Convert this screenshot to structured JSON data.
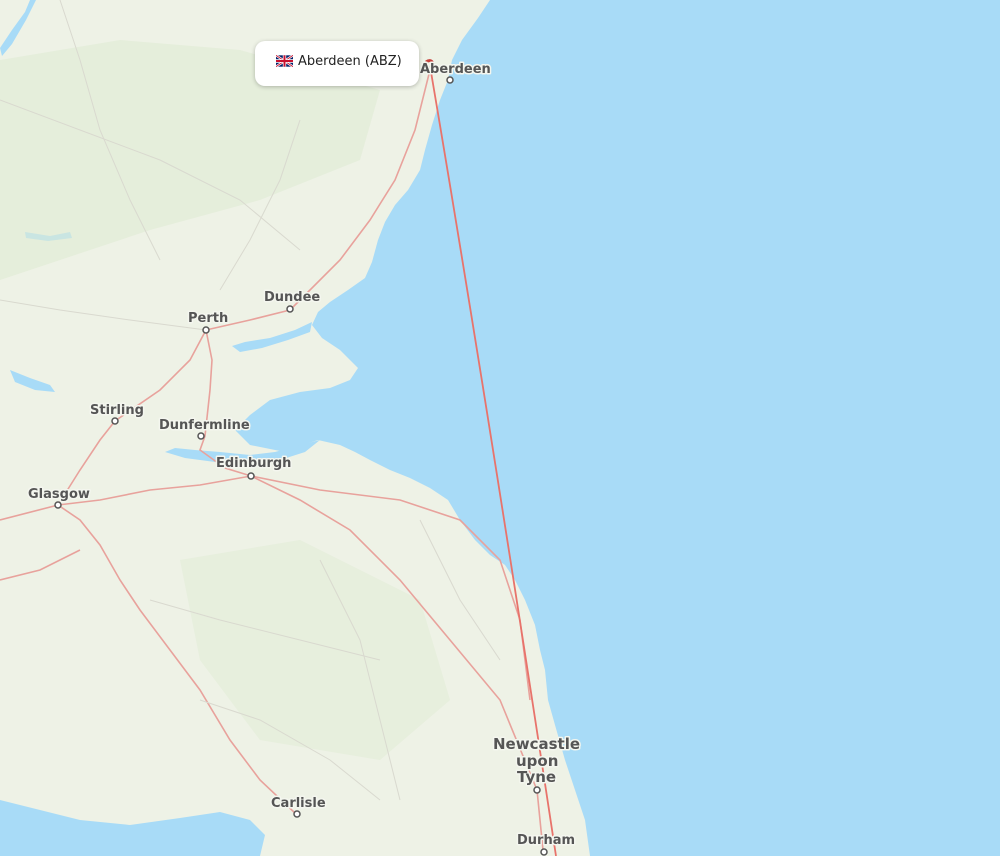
{
  "map": {
    "airport_label": "Aberdeen (ABZ)",
    "origin_flag_icon": "uk-flag-icon",
    "cities": [
      {
        "id": "aberdeen",
        "name": "Aberdeen"
      },
      {
        "id": "dundee",
        "name": "Dundee"
      },
      {
        "id": "perth",
        "name": "Perth"
      },
      {
        "id": "stirling",
        "name": "Stirling"
      },
      {
        "id": "dunfermline",
        "name": "Dunfermline"
      },
      {
        "id": "edinburgh",
        "name": "Edinburgh"
      },
      {
        "id": "glasgow",
        "name": "Glasgow"
      },
      {
        "id": "newcastle",
        "name_lines": [
          "Newcastle",
          "upon",
          "Tyne"
        ]
      },
      {
        "id": "carlisle",
        "name": "Carlisle"
      },
      {
        "id": "durham",
        "name": "Durham"
      }
    ],
    "colors": {
      "sea": "#a8dbf7",
      "land": "#eef2e6",
      "route": "#e8736b",
      "road": "#e8a29c"
    }
  }
}
